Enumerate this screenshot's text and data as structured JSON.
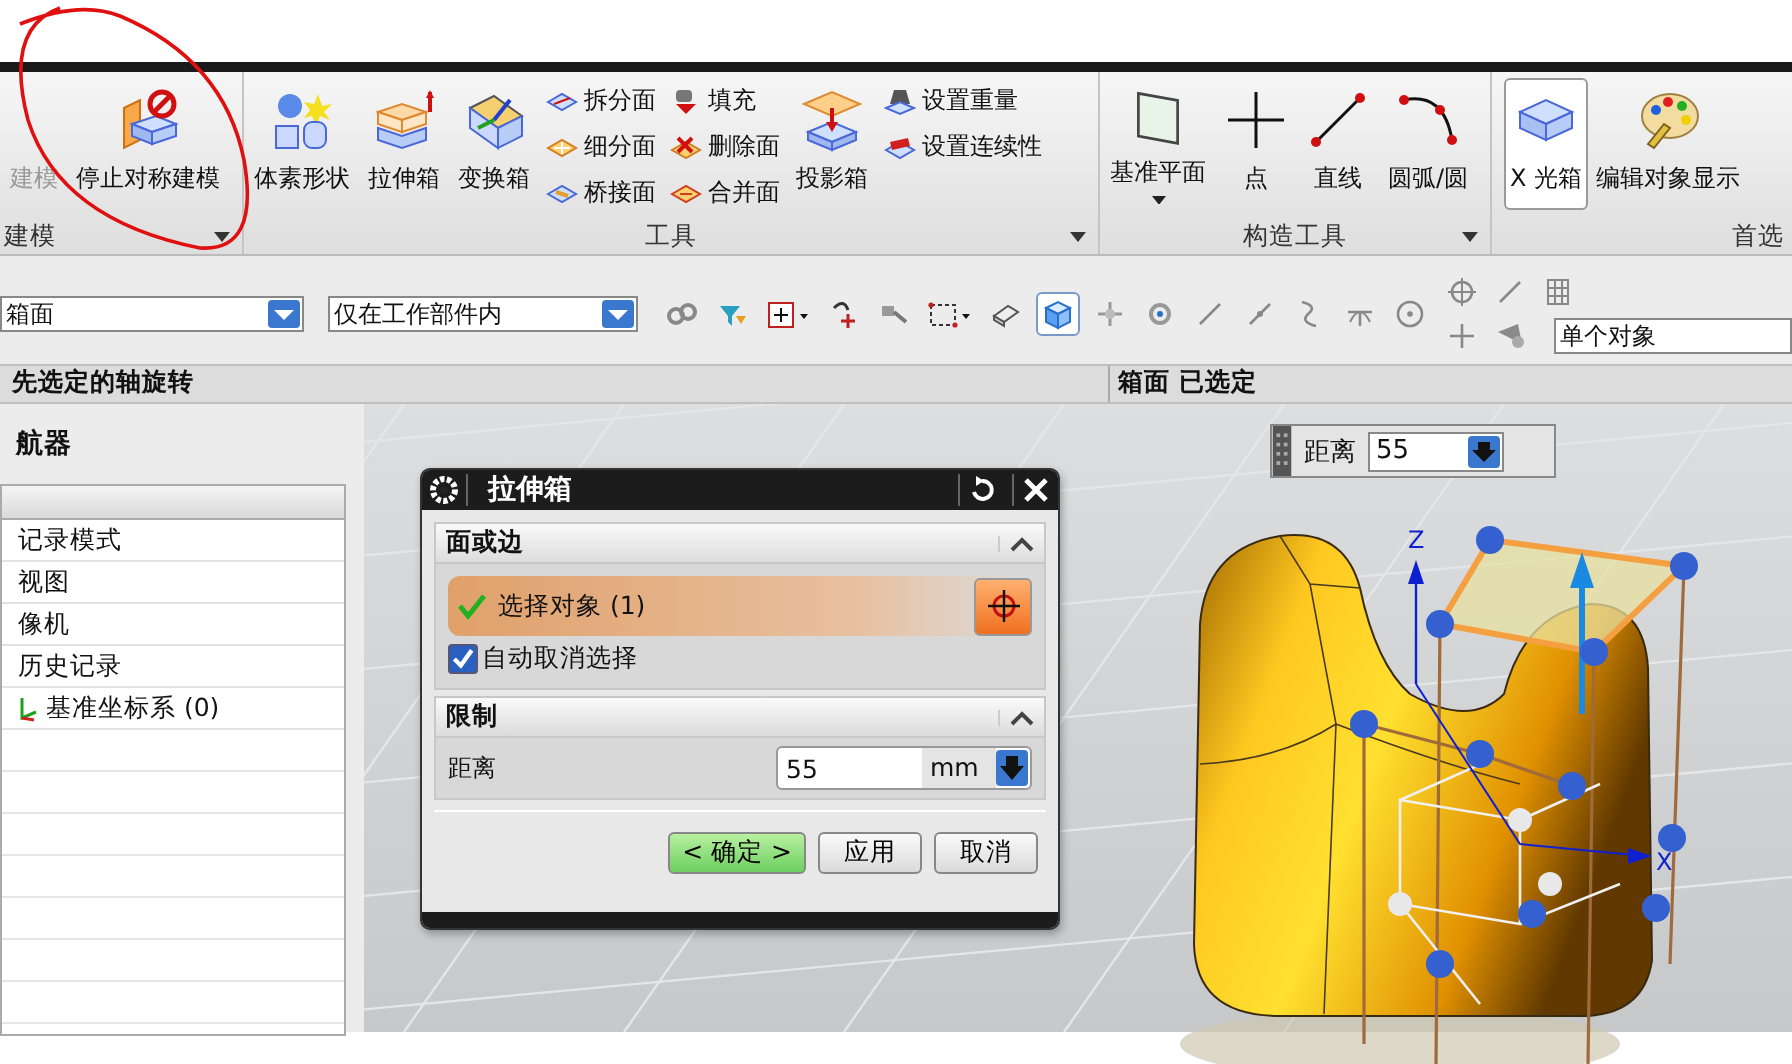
{
  "ribbon": {
    "groups": [
      {
        "label": "建模",
        "has_menu": true,
        "columns": [
          {
            "kind": "big",
            "label": "建模",
            "disabled": true
          },
          {
            "kind": "big",
            "label": "停止对称建模",
            "disabled": false
          }
        ]
      },
      {
        "label": "工具",
        "has_menu": true,
        "columns": [
          {
            "kind": "big",
            "label": "体素形状",
            "disabled": false
          },
          {
            "kind": "big",
            "label": "拉伸箱",
            "disabled": false
          },
          {
            "kind": "big",
            "label": "变换箱",
            "disabled": false
          },
          {
            "kind": "stack",
            "items": [
              "拆分面",
              "细分面",
              "桥接面"
            ]
          },
          {
            "kind": "stack",
            "items": [
              "填充",
              "删除面",
              "合并面"
            ]
          },
          {
            "kind": "big",
            "label": "投影箱",
            "disabled": false
          },
          {
            "kind": "stack",
            "items": [
              "设置重量",
              "设置连续性"
            ]
          }
        ]
      },
      {
        "label": "构造工具",
        "has_menu": true,
        "columns": [
          {
            "kind": "big",
            "label": "基准平面",
            "disabled": false,
            "has_menu": true
          },
          {
            "kind": "big",
            "label": "点",
            "disabled": false,
            "has_menu": false
          },
          {
            "kind": "big",
            "label": "直线",
            "disabled": false,
            "has_menu": false
          },
          {
            "kind": "big",
            "label": "圆弧/圆",
            "disabled": false,
            "has_menu": false
          }
        ]
      },
      {
        "label": "首选",
        "has_menu": false,
        "columns": [
          {
            "kind": "big",
            "label": "X 光箱",
            "disabled": false,
            "on": true
          },
          {
            "kind": "big",
            "label": "编辑对象显示",
            "disabled": false,
            "on": false
          }
        ]
      }
    ]
  },
  "toolbar": {
    "type_filter": "箱面",
    "scope_filter": "仅在工作部件内",
    "selection_mode": "单个对象",
    "tools": [
      {
        "on": false
      },
      {
        "on": false
      },
      {
        "on": false
      },
      {
        "on": false
      },
      {
        "on": false
      },
      {
        "on": false
      },
      {
        "on": false
      },
      {
        "on": true
      },
      {
        "on": false
      },
      {
        "on": false
      },
      {
        "on": false
      },
      {
        "on": false
      },
      {
        "on": false
      },
      {
        "on": false
      },
      {
        "on": false
      },
      {
        "on": false
      },
      {
        "on": false
      },
      {
        "on": false
      },
      {
        "on": false
      },
      {
        "on": false
      }
    ]
  },
  "status_bar": {
    "prompt": "先选定的轴旋转",
    "selection": "箱面 已选定"
  },
  "navigator": {
    "title": "航器",
    "rows": [
      {
        "kind": "text",
        "label": "记录模式"
      },
      {
        "kind": "text",
        "label": "视图"
      },
      {
        "kind": "text",
        "label": "像机"
      },
      {
        "kind": "text",
        "label": "历史记录"
      },
      {
        "kind": "datum",
        "label": "基准坐标系 (0)"
      }
    ]
  },
  "dialog": {
    "title": "拉伸箱",
    "sections": [
      {
        "title": "面或边",
        "expanded": true
      },
      {
        "title": "限制",
        "expanded": true
      }
    ],
    "selection": {
      "label": "选择对象 (1)",
      "complete": true
    },
    "auto_deselect": {
      "label": "自动取消选择",
      "checked": true
    },
    "distance": {
      "label": "距离",
      "value": "55",
      "unit": "mm"
    },
    "buttons": [
      {
        "label": "< 确定 >",
        "default": true
      },
      {
        "label": "应用",
        "default": false
      },
      {
        "label": "取消",
        "default": false
      }
    ]
  },
  "floating_input": {
    "label": "距离",
    "value": "55"
  },
  "axes": [
    "Z",
    "X"
  ]
}
